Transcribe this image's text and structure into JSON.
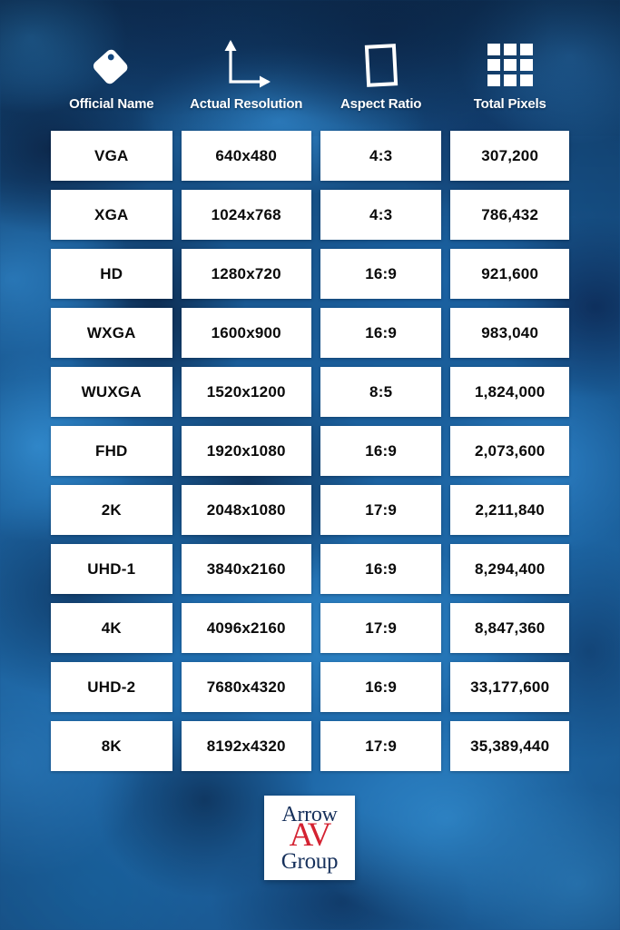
{
  "table": {
    "headers": [
      {
        "label": "Official Name",
        "icon": "tag-icon"
      },
      {
        "label": "Actual Resolution",
        "icon": "axes-arrows-icon"
      },
      {
        "label": "Aspect Ratio",
        "icon": "rectangle-frame-icon"
      },
      {
        "label": "Total Pixels",
        "icon": "pixel-grid-icon"
      }
    ],
    "rows": [
      {
        "name": "VGA",
        "resolution": "640x480",
        "aspect": "4:3",
        "pixels": "307,200"
      },
      {
        "name": "XGA",
        "resolution": "1024x768",
        "aspect": "4:3",
        "pixels": "786,432"
      },
      {
        "name": "HD",
        "resolution": "1280x720",
        "aspect": "16:9",
        "pixels": "921,600"
      },
      {
        "name": "WXGA",
        "resolution": "1600x900",
        "aspect": "16:9",
        "pixels": "983,040"
      },
      {
        "name": "WUXGA",
        "resolution": "1520x1200",
        "aspect": "8:5",
        "pixels": "1,824,000"
      },
      {
        "name": "FHD",
        "resolution": "1920x1080",
        "aspect": "16:9",
        "pixels": "2,073,600"
      },
      {
        "name": "2K",
        "resolution": "2048x1080",
        "aspect": "17:9",
        "pixels": "2,211,840"
      },
      {
        "name": "UHD-1",
        "resolution": "3840x2160",
        "aspect": "16:9",
        "pixels": "8,294,400"
      },
      {
        "name": "4K",
        "resolution": "4096x2160",
        "aspect": "17:9",
        "pixels": "8,847,360"
      },
      {
        "name": "UHD-2",
        "resolution": "7680x4320",
        "aspect": "16:9",
        "pixels": "33,177,600"
      },
      {
        "name": "8K",
        "resolution": "8192x4320",
        "aspect": "17:9",
        "pixels": "35,389,440"
      }
    ]
  },
  "logo": {
    "line1": "Arrow",
    "line2": "AV",
    "line3": "Group"
  },
  "colors": {
    "background_blue": "#1a5d99",
    "background_dark_blue": "#12406f",
    "cell_background": "#ffffff",
    "cell_text": "#0a0a0a",
    "header_text": "#ffffff",
    "logo_navy": "#17315c",
    "logo_red": "#d42231"
  }
}
